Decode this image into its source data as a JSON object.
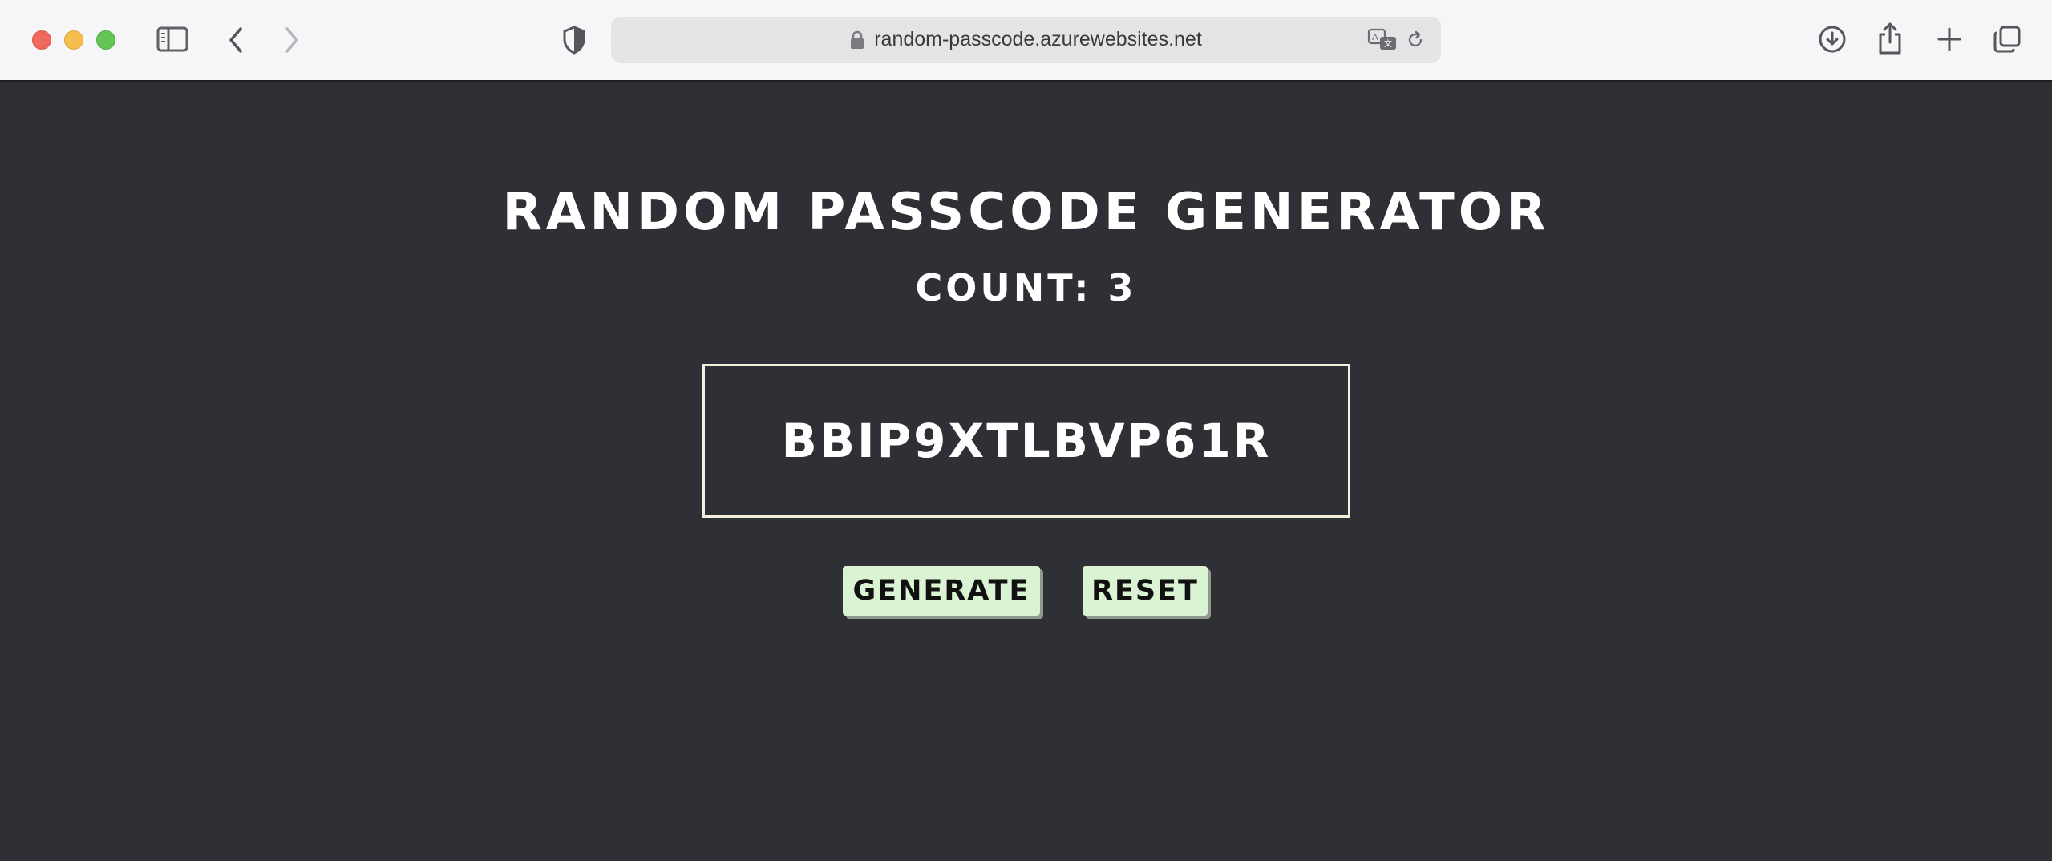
{
  "browser": {
    "url": "random-passcode.azurewebsites.net"
  },
  "icons": {
    "sidebar": "sidebar-icon",
    "back": "chevron-left-icon",
    "forward": "chevron-right-icon",
    "privacy": "shield-icon",
    "lock": "lock-icon",
    "translate": "translate-icon",
    "reload": "reload-icon",
    "downloads": "download-icon",
    "share": "share-icon",
    "new_tab": "plus-icon",
    "tabs_overview": "tabs-icon"
  },
  "app": {
    "title": "RANDOM PASSCODE GENERATOR",
    "count_label": "COUNT: 3",
    "passcode": "BBIP9XTLBVP61R",
    "generate_label": "GENERATE",
    "reset_label": "RESET"
  },
  "colors": {
    "page_background": "#2f3035",
    "button_background": "#d9f3d3",
    "passcode_border": "#f3efdc"
  }
}
